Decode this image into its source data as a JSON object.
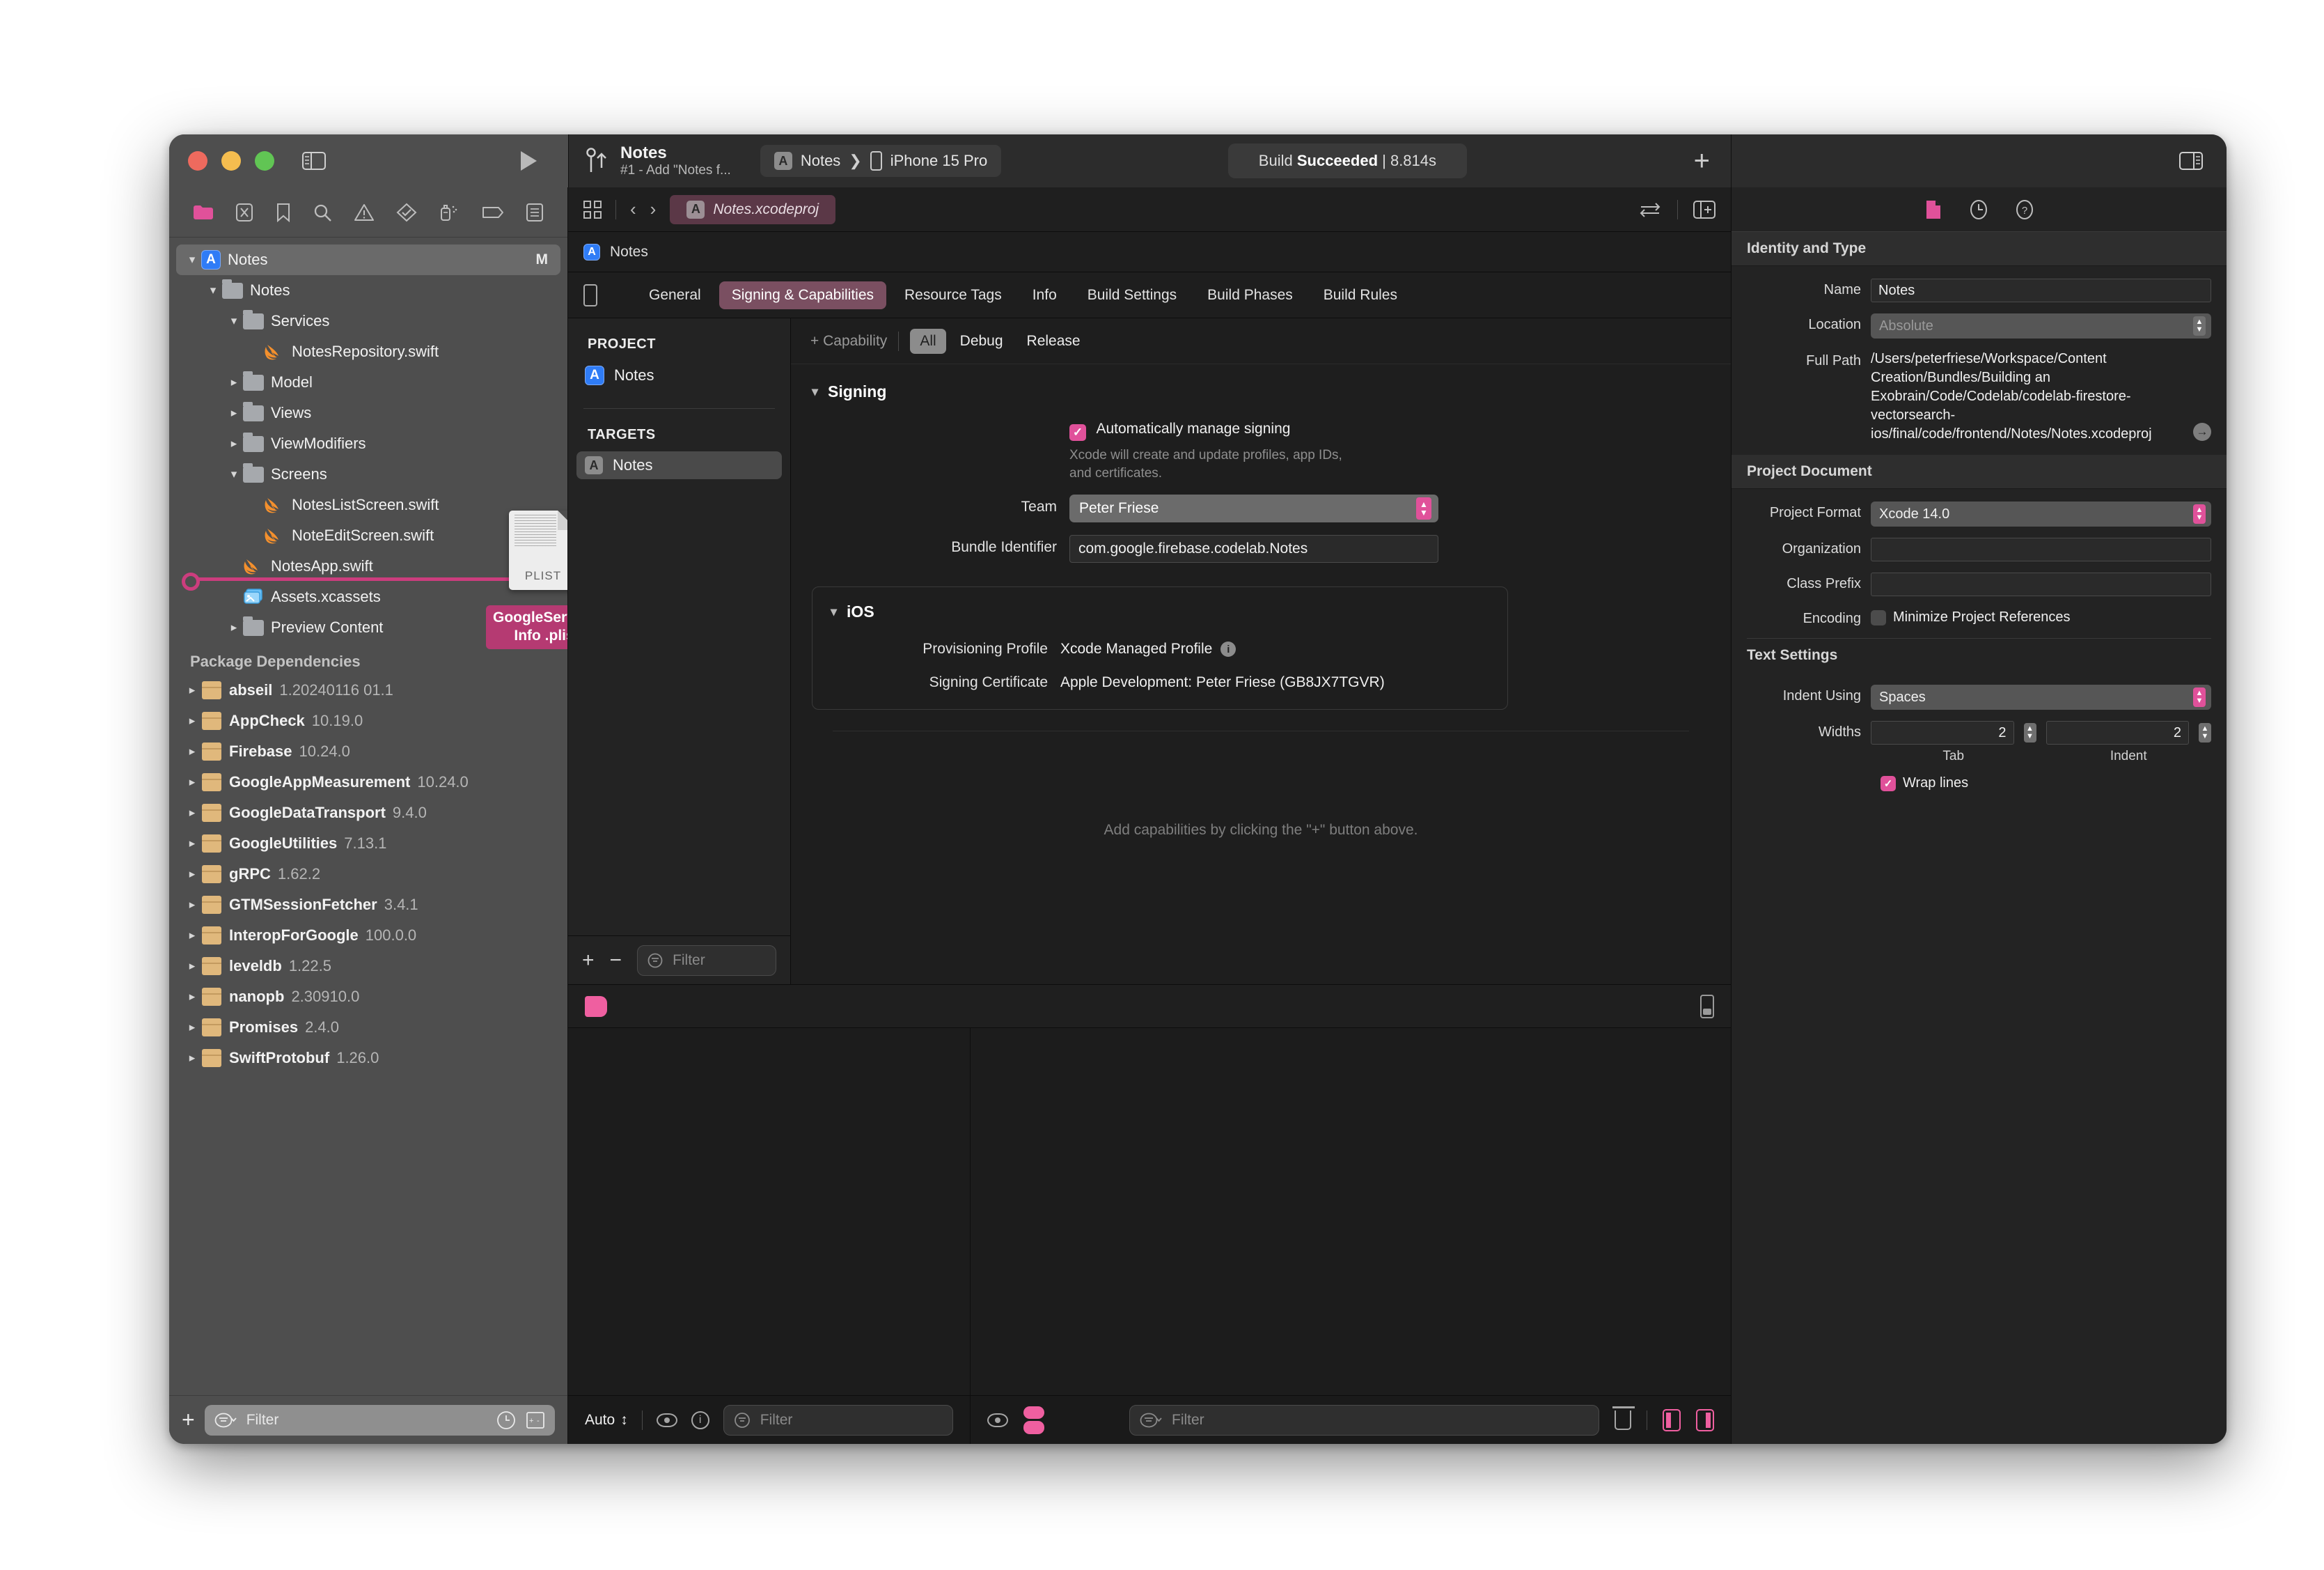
{
  "window": {
    "traffic_lights": [
      "close",
      "minimize",
      "zoom"
    ],
    "sidebar_toggle": "sidebar-toggle-icon",
    "run_button": "run-icon"
  },
  "toolbar": {
    "branch_title": "Notes",
    "branch_subtitle": "#1 - Add \"Notes f...",
    "scheme_name": "Notes",
    "scheme_separator": "❯",
    "destination": "iPhone 15 Pro",
    "status_prefix": "Build ",
    "status_result": "Succeeded",
    "status_time": " | 8.814s",
    "add_label": "+",
    "inspector_toggle": "inspector-toggle-icon"
  },
  "navigator": {
    "toolbar_icons": [
      "folder-icon",
      "source-control-icon",
      "bookmark-icon",
      "search-icon",
      "warning-icon",
      "test-icon",
      "debug-icon",
      "breakpoint-icon",
      "report-icon"
    ],
    "tree": [
      {
        "depth": 0,
        "disc": "open",
        "icon": "app-icon",
        "label": "Notes",
        "badge": "M",
        "selected": true
      },
      {
        "depth": 1,
        "disc": "open",
        "icon": "folder-icon",
        "label": "Notes"
      },
      {
        "depth": 2,
        "disc": "open",
        "icon": "folder-icon",
        "label": "Services"
      },
      {
        "depth": 3,
        "disc": "none",
        "icon": "swift-icon",
        "label": "NotesRepository.swift"
      },
      {
        "depth": 2,
        "disc": "closed",
        "icon": "folder-icon",
        "label": "Model"
      },
      {
        "depth": 2,
        "disc": "closed",
        "icon": "folder-icon",
        "label": "Views"
      },
      {
        "depth": 2,
        "disc": "closed",
        "icon": "folder-icon",
        "label": "ViewModifiers"
      },
      {
        "depth": 2,
        "disc": "open",
        "icon": "folder-icon",
        "label": "Screens"
      },
      {
        "depth": 3,
        "disc": "none",
        "icon": "swift-icon",
        "label": "NotesListScreen.swift"
      },
      {
        "depth": 3,
        "disc": "none",
        "icon": "swift-icon",
        "label": "NoteEditScreen.swift"
      },
      {
        "depth": 2,
        "disc": "none",
        "icon": "swift-icon",
        "label": "NotesApp.swift"
      },
      {
        "depth": 2,
        "disc": "none",
        "icon": "assets-icon",
        "label": "Assets.xcassets"
      },
      {
        "depth": 2,
        "disc": "closed",
        "icon": "folder-icon",
        "label": "Preview Content"
      }
    ],
    "packages_header": "Package Dependencies",
    "packages": [
      {
        "name": "abseil",
        "version": "1.20240116 01.1"
      },
      {
        "name": "AppCheck",
        "version": "10.19.0"
      },
      {
        "name": "Firebase",
        "version": "10.24.0"
      },
      {
        "name": "GoogleAppMeasurement",
        "version": "10.24.0"
      },
      {
        "name": "GoogleDataTransport",
        "version": "9.4.0"
      },
      {
        "name": "GoogleUtilities",
        "version": "7.13.1"
      },
      {
        "name": "gRPC",
        "version": "1.62.2"
      },
      {
        "name": "GTMSessionFetcher",
        "version": "3.4.1"
      },
      {
        "name": "InteropForGoogle",
        "version": "100.0.0"
      },
      {
        "name": "leveldb",
        "version": "1.22.5"
      },
      {
        "name": "nanopb",
        "version": "2.30910.0"
      },
      {
        "name": "Promises",
        "version": "2.4.0"
      },
      {
        "name": "SwiftProtobuf",
        "version": "1.26.0"
      }
    ],
    "drag": {
      "doc_type_label": "PLIST",
      "badge_line1": "GoogleService-",
      "badge_line2": "Info .plist",
      "badge_color": "#b53a72"
    },
    "bottom": {
      "add_label": "+",
      "filter_placeholder": "Filter",
      "recent_icon": "clock-icon",
      "changes_icon": "source-diff-icon"
    }
  },
  "editor": {
    "toolbar": {
      "grid_icon": "minimap-grid-icon",
      "back_icon": "‹",
      "forward_icon": "›",
      "tab_label": "Notes.xcodeproj",
      "compare_icon": "compare-icon",
      "add_editor_icon": "add-editor-icon"
    },
    "jumpbar_label": "Notes",
    "tabs": [
      {
        "label": "General",
        "active": false
      },
      {
        "label": "Signing & Capabilities",
        "active": true
      },
      {
        "label": "Resource Tags",
        "active": false
      },
      {
        "label": "Info",
        "active": false
      },
      {
        "label": "Build Settings",
        "active": false
      },
      {
        "label": "Build Phases",
        "active": false
      },
      {
        "label": "Build Rules",
        "active": false
      }
    ],
    "project_list": {
      "project_header": "PROJECT",
      "project_items": [
        {
          "label": "Notes",
          "selected": false
        }
      ],
      "targets_header": "TARGETS",
      "target_items": [
        {
          "label": "Notes",
          "selected": true
        }
      ],
      "add_label": "+",
      "remove_label": "−",
      "filter_placeholder": "Filter"
    },
    "capability_bar": {
      "add_capability": "+ Capability",
      "segments": [
        {
          "label": "All",
          "active": true
        },
        {
          "label": "Debug",
          "active": false
        },
        {
          "label": "Release",
          "active": false
        }
      ]
    },
    "signing": {
      "section_title": "Signing",
      "auto_manage_label": "Automatically manage signing",
      "auto_manage_checked": true,
      "auto_manage_hint": "Xcode will create and update profiles, app IDs, and certificates.",
      "team_label": "Team",
      "team_value": "Peter Friese",
      "bundle_label": "Bundle Identifier",
      "bundle_value": "com.google.firebase.codelab.Notes"
    },
    "ios_section": {
      "title": "iOS",
      "provisioning_label": "Provisioning Profile",
      "provisioning_value": "Xcode Managed Profile",
      "certificate_label": "Signing Certificate",
      "certificate_value": "Apple Development: Peter Friese (GB8JX7TGVR)"
    },
    "empty_hint": "Add capabilities by clicking the \"+\" button above."
  },
  "debug_area": {
    "topbar": {
      "tag_color": "#ef5fa0",
      "device_icon": "mini-device-icon"
    },
    "bottom_left": {
      "auto_label": "Auto",
      "eye_icon": "eye-icon",
      "info_icon": "info-icon",
      "filter_placeholder": "Filter"
    },
    "bottom_right": {
      "filter_placeholder": "Filter",
      "trash_icon": "trash-icon",
      "panel_left_icon": "panel-left-icon",
      "panel_right_icon": "panel-right-icon"
    }
  },
  "inspector": {
    "tabs": [
      "file-inspector-icon",
      "history-inspector-icon",
      "quick-help-icon"
    ],
    "active_tab": 0,
    "identity": {
      "header": "Identity and Type",
      "name_label": "Name",
      "name_value": "Notes",
      "location_label": "Location",
      "location_value": "Absolute",
      "fullpath_label": "Full Path",
      "fullpath_value": "/Users/peterfriese/Workspace/Content Creation/Bundles/Building an Exobrain/Code/Codelab/codelab-firestore-vectorsearch-ios/final/code/frontend/Notes/Notes.xcodeproj"
    },
    "project_document": {
      "header": "Project Document",
      "format_label": "Project Format",
      "format_value": "Xcode 14.0",
      "organization_label": "Organization",
      "organization_value": "",
      "class_prefix_label": "Class Prefix",
      "class_prefix_value": "",
      "encoding_label": "Encoding",
      "minimize_label": "Minimize Project References",
      "minimize_checked": false
    },
    "text_settings": {
      "header": "Text Settings",
      "indent_label": "Indent Using",
      "indent_value": "Spaces",
      "widths_label": "Widths",
      "tab_width": "2",
      "indent_width": "2",
      "tab_caption": "Tab",
      "indent_caption": "Indent",
      "wrap_label": "Wrap lines",
      "wrap_checked": true
    }
  },
  "colors": {
    "accent_pink": "#e0519a",
    "tab_active": "#7a4f61",
    "drag_badge": "#b53a72"
  }
}
